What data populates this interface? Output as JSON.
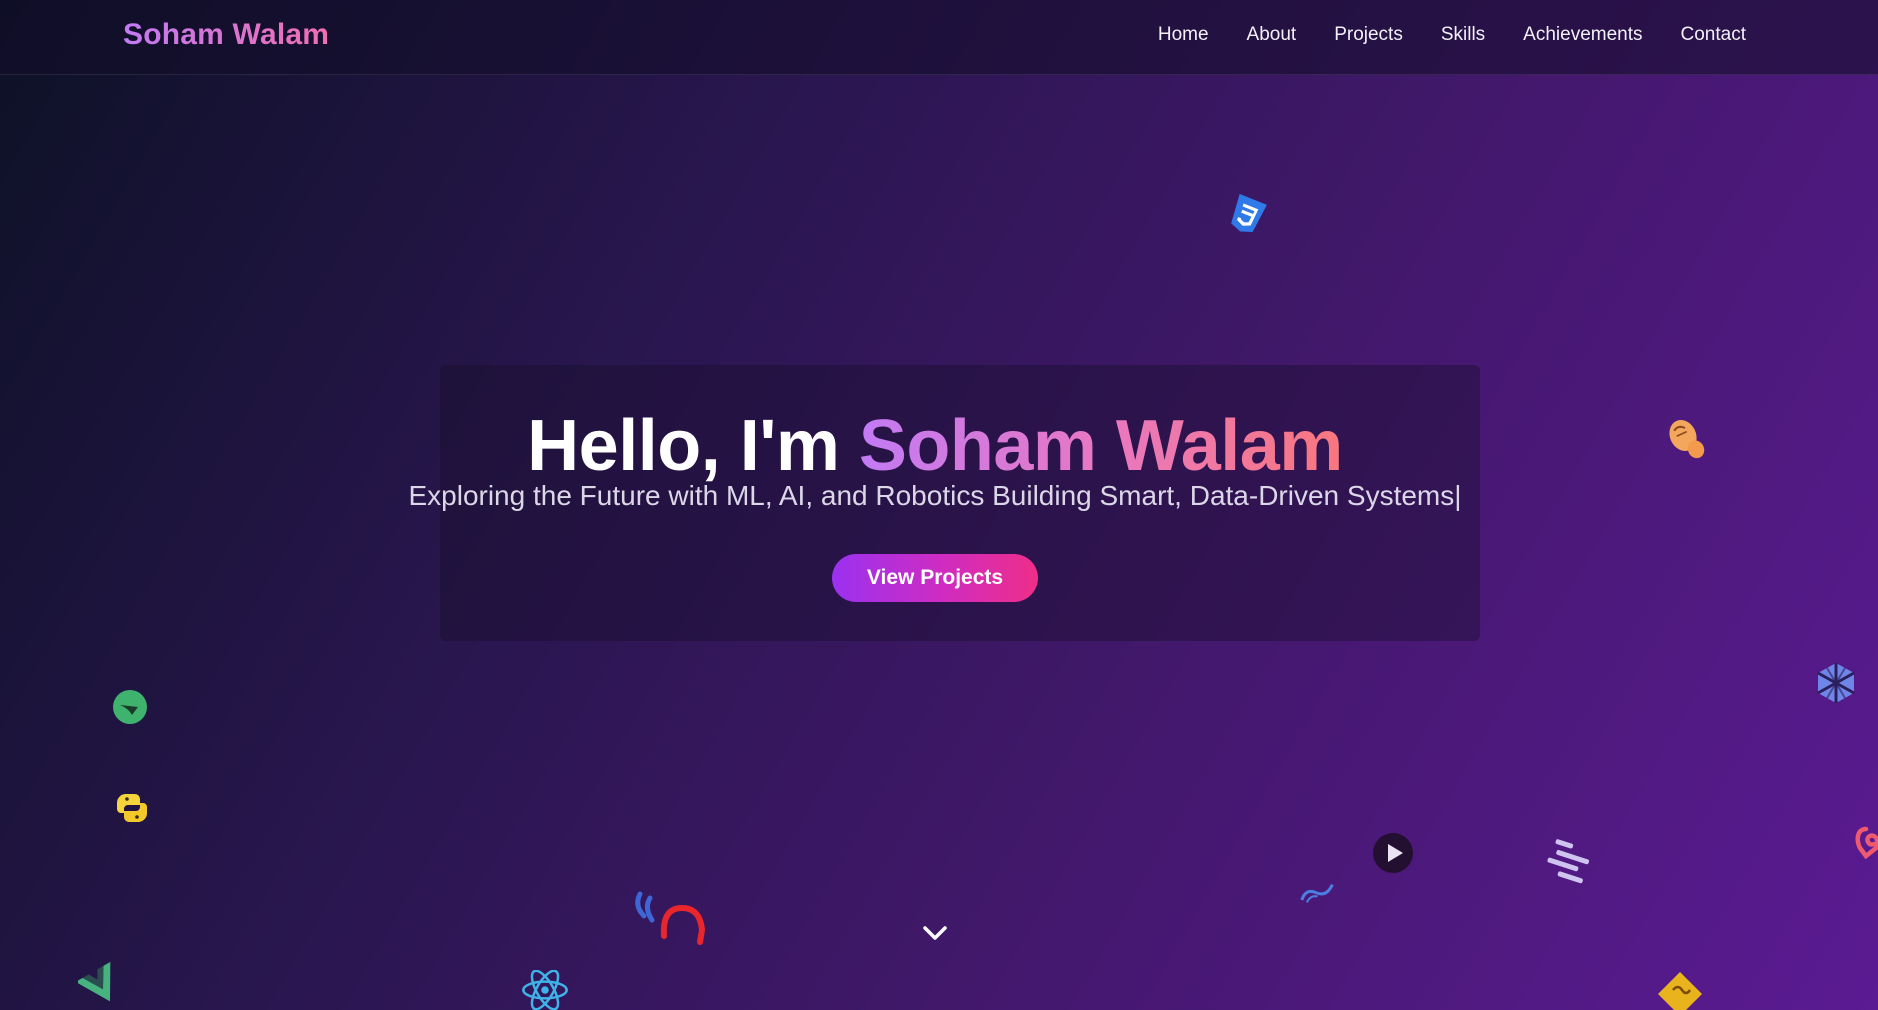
{
  "nav": {
    "brand": "Soham Walam",
    "links": [
      "Home",
      "About",
      "Projects",
      "Skills",
      "Achievements",
      "Contact"
    ]
  },
  "hero": {
    "greeting": "Hello, I'm",
    "name": "Soham Walam",
    "subtitle": "Exploring the Future with ML, AI, and Robotics Building Smart, Data-Driven Systems",
    "cursor": "|",
    "cta_label": "View Projects"
  },
  "floating_icons": [
    "css3-icon",
    "postman-icon",
    "codepen-cube-icon",
    "angular-icon",
    "spring-icon",
    "python-icon",
    "firebase-icon",
    "tailwind-icon",
    "play-icon",
    "git-stripes-icon",
    "vue-icon",
    "react-icon",
    "sf-icon",
    "scroll-down-chevron-icon"
  ],
  "colors": {
    "brand_gradient_start": "#c27af4",
    "brand_gradient_end": "#f06fb1",
    "cta_gradient_start": "#9b31f0",
    "cta_gradient_end": "#ee2e88",
    "background_dark": "#0d1126",
    "background_purple": "#5b1b93"
  }
}
